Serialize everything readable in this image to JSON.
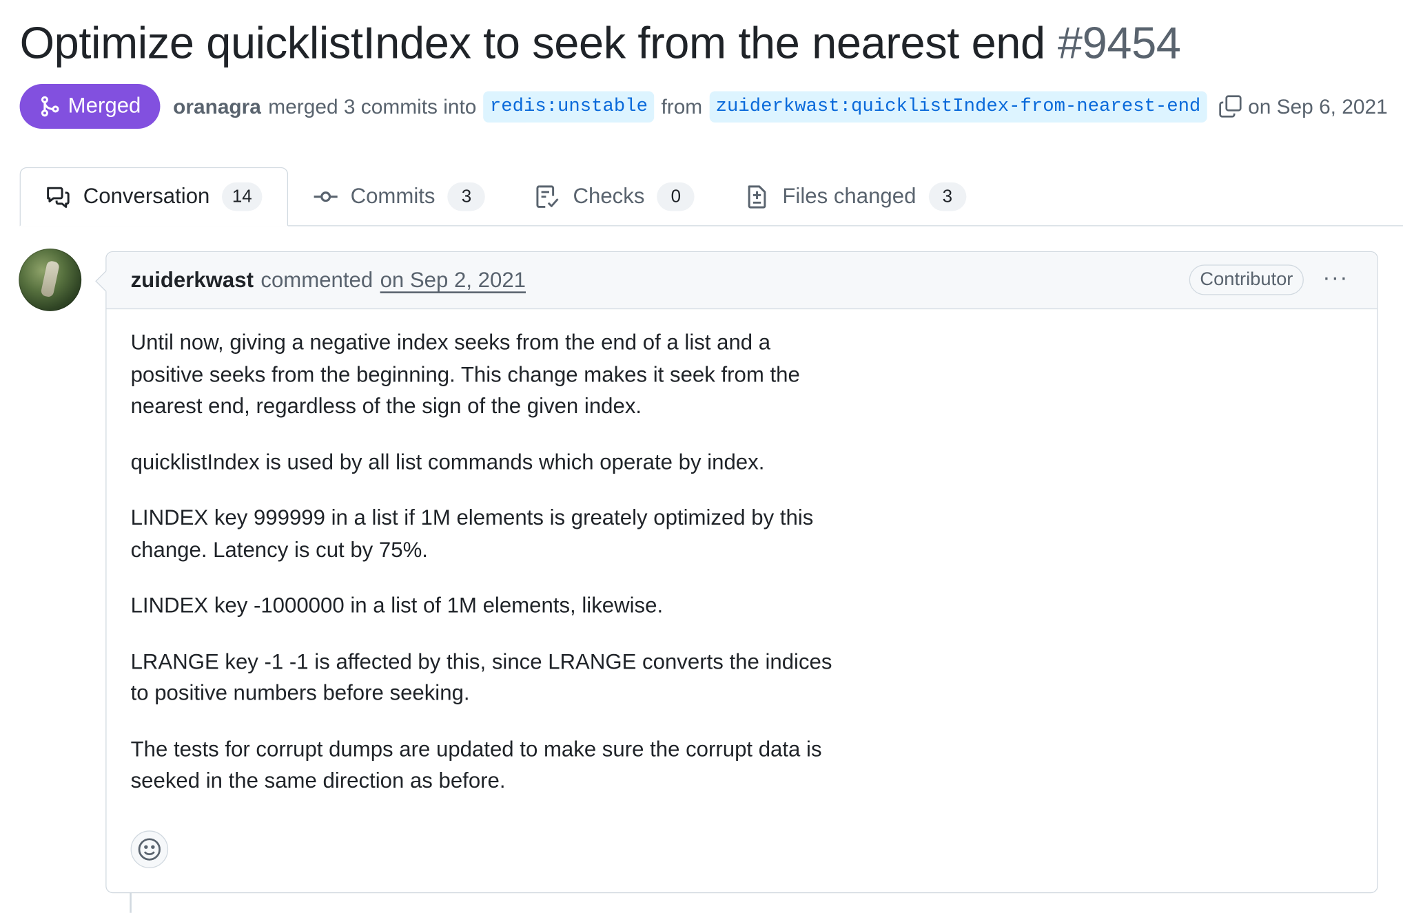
{
  "pull_request": {
    "title": "Optimize quicklistIndex to seek from the nearest end",
    "number": "#9454",
    "state": "Merged",
    "state_color": "#8250df",
    "author": "oranagra",
    "merge_text": "merged 3 commits into",
    "base_branch": "redis:unstable",
    "from_text": "from",
    "head_branch": "zuiderkwast:quicklistIndex-from-nearest-end",
    "merged_date": "on Sep 6, 2021"
  },
  "tabs": [
    {
      "label": "Conversation",
      "count": "14",
      "icon": "comment-discussion-icon",
      "selected": true
    },
    {
      "label": "Commits",
      "count": "3",
      "icon": "git-commit-icon",
      "selected": false
    },
    {
      "label": "Checks",
      "count": "0",
      "icon": "checklist-icon",
      "selected": false
    },
    {
      "label": "Files changed",
      "count": "3",
      "icon": "file-diff-icon",
      "selected": false
    }
  ],
  "comment": {
    "author": "zuiderkwast",
    "verb": "commented",
    "date": "on Sep 2, 2021",
    "role_badge": "Contributor",
    "menu_label": "···",
    "paragraphs": [
      "Until now, giving a negative index seeks from the end of a list and a positive seeks from the beginning. This change makes it seek from the nearest end, regardless of the sign of the given index.",
      "quicklistIndex is used by all list commands which operate by index.",
      "LINDEX key 999999 in a list if 1M elements is greately optimized by this change. Latency is cut by 75%.",
      "LINDEX key -1000000 in a list of 1M elements, likewise.",
      "LRANGE key -1 -1 is affected by this, since LRANGE converts the indices to positive numbers before seeking.",
      "The tests for corrupt dumps are updated to make sure the corrupt data is seeked in the same direction as before."
    ],
    "reaction_icon": "smiley-icon"
  },
  "colors": {
    "link": "#0969da",
    "branch_bg": "#ddf4ff",
    "muted_text": "#59636e",
    "border": "#d1d9e0"
  }
}
